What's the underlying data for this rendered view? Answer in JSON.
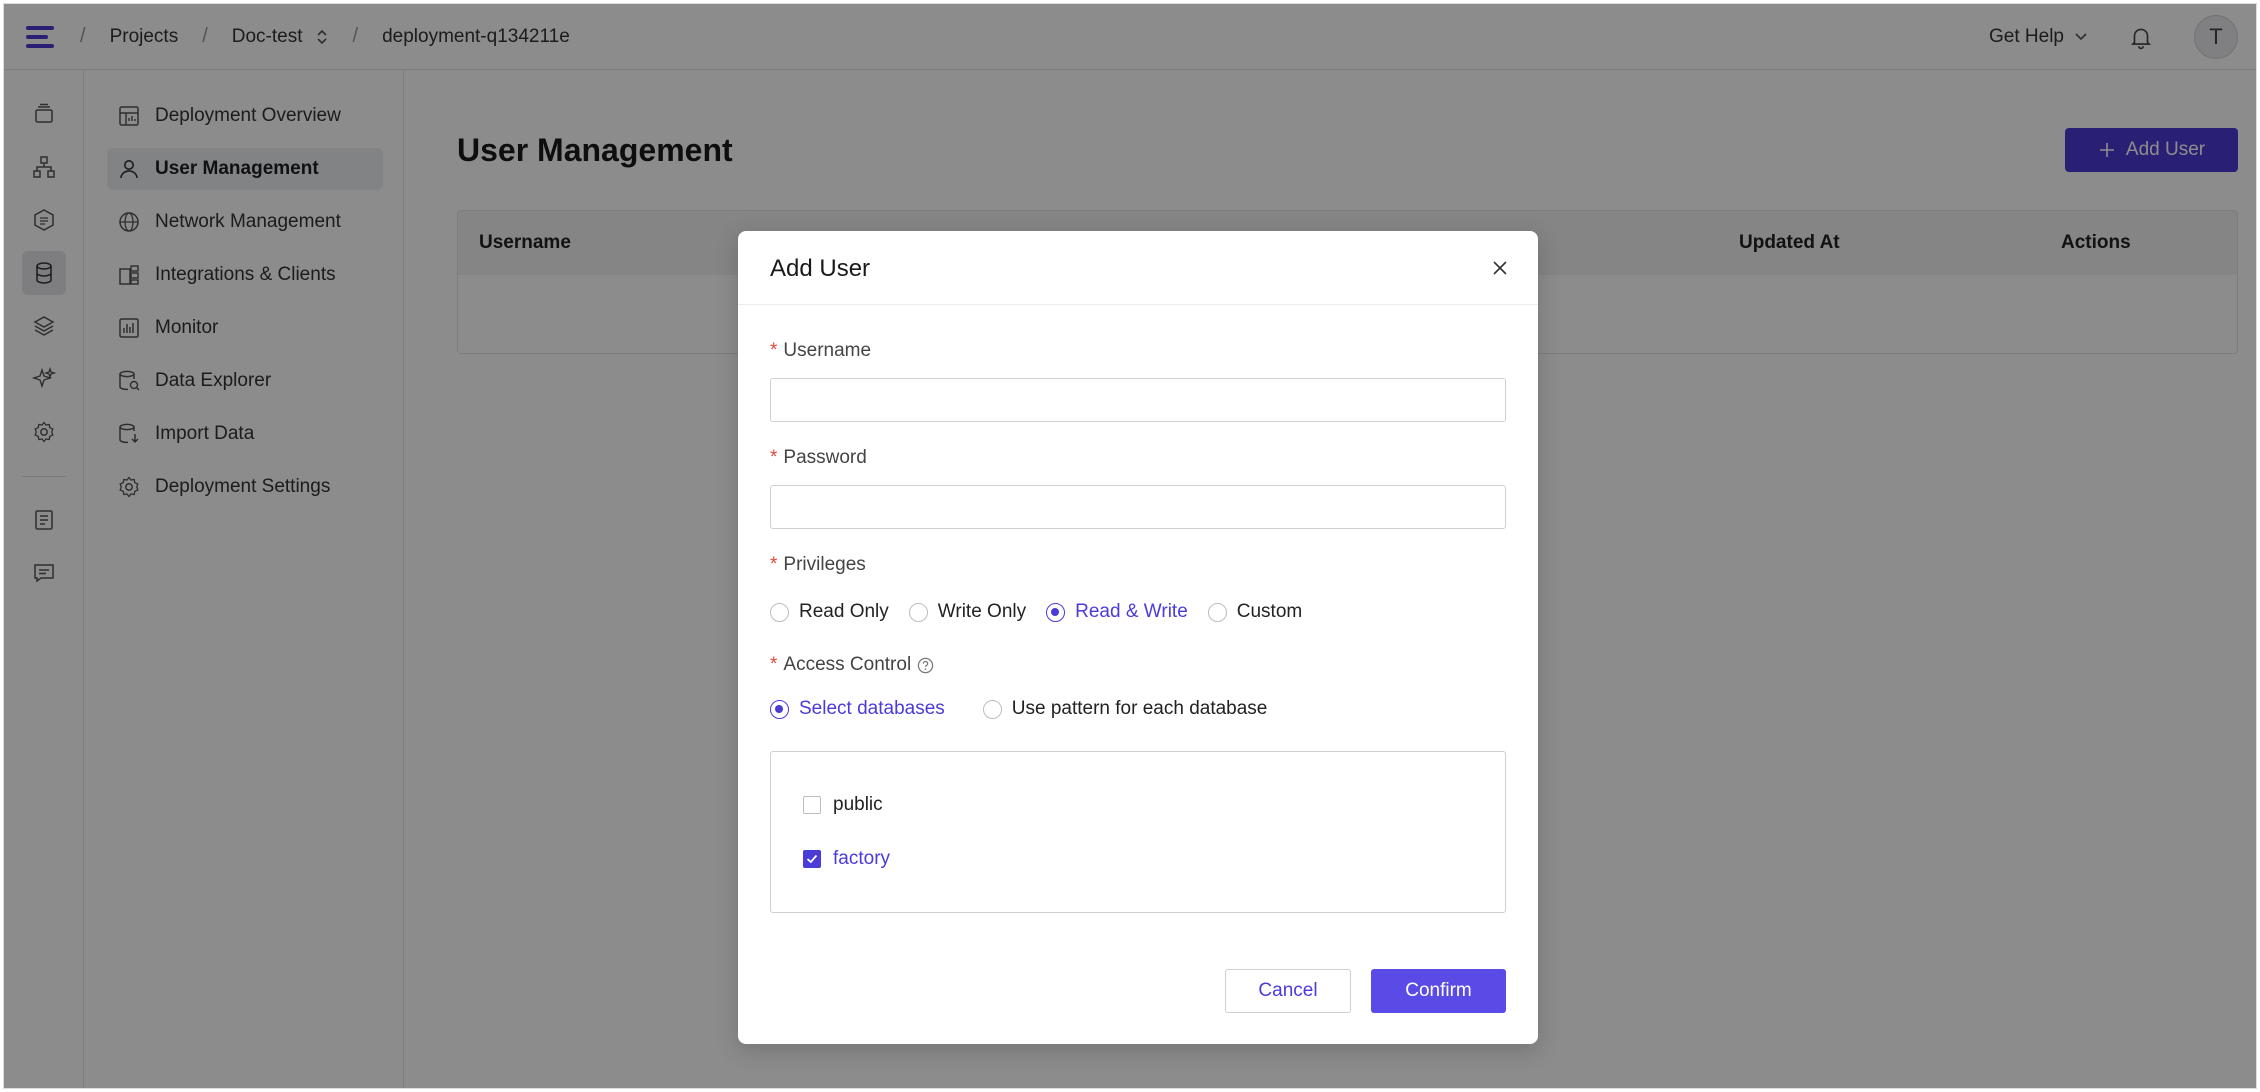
{
  "topbar": {
    "breadcrumb": [
      "Projects",
      "Doc-test",
      "deployment-q134211e"
    ],
    "help_label": "Get Help",
    "avatar_initial": "T"
  },
  "rail": {
    "icons": [
      "stack-icon",
      "topology-icon",
      "hexagon-icon",
      "database-icon",
      "layers-icon",
      "sparkle-icon",
      "settings-icon",
      "document-icon",
      "chat-icon"
    ],
    "active_index": 3
  },
  "nav": {
    "items": [
      {
        "label": "Deployment Overview",
        "icon": "dashboard-icon"
      },
      {
        "label": "User Management",
        "icon": "user-icon",
        "active": true
      },
      {
        "label": "Network Management",
        "icon": "globe-icon"
      },
      {
        "label": "Integrations & Clients",
        "icon": "integrations-icon"
      },
      {
        "label": "Monitor",
        "icon": "chart-icon"
      },
      {
        "label": "Data Explorer",
        "icon": "data-explorer-icon"
      },
      {
        "label": "Import Data",
        "icon": "import-icon"
      },
      {
        "label": "Deployment Settings",
        "icon": "gear-icon"
      }
    ]
  },
  "main": {
    "title": "User Management",
    "add_user_label": "Add User",
    "table": {
      "columns": [
        "Username",
        "Updated At",
        "Actions"
      ]
    }
  },
  "modal": {
    "title": "Add User",
    "username_label": "Username",
    "username_value": "",
    "password_label": "Password",
    "password_value": "",
    "privileges_label": "Privileges",
    "privileges": [
      "Read Only",
      "Write Only",
      "Read & Write",
      "Custom"
    ],
    "privileges_selected": "Read & Write",
    "access_control_label": "Access Control",
    "access_modes": [
      "Select databases",
      "Use pattern for each database"
    ],
    "access_selected": "Select databases",
    "databases": [
      {
        "name": "public",
        "checked": false
      },
      {
        "name": "factory",
        "checked": true
      }
    ],
    "cancel_label": "Cancel",
    "confirm_label": "Confirm"
  },
  "colors": {
    "accent": "#4b3bd8",
    "required": "#e5483a"
  }
}
